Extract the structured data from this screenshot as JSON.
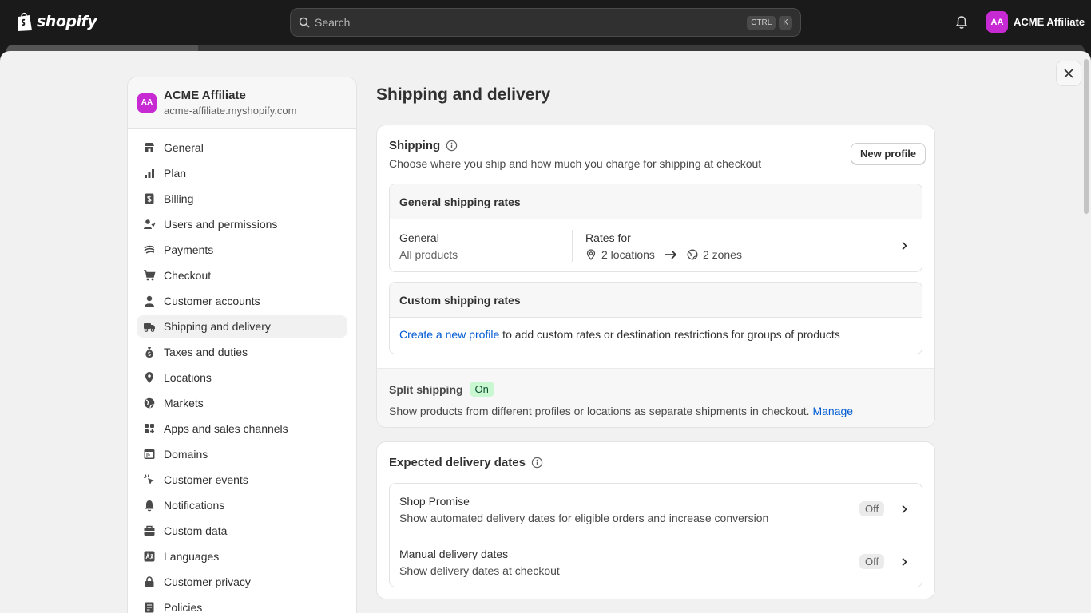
{
  "topbar": {
    "brand": "shopify",
    "search_placeholder": "Search",
    "shortcut_ctrl": "CTRL",
    "shortcut_key": "K",
    "account_initials": "AA",
    "account_name": "ACME Affiliate"
  },
  "store": {
    "initials": "AA",
    "name": "ACME Affiliate",
    "domain": "acme-affiliate.myshopify.com"
  },
  "sidebar": {
    "items": [
      {
        "label": "General",
        "icon": "store-icon"
      },
      {
        "label": "Plan",
        "icon": "plan-chart-icon"
      },
      {
        "label": "Billing",
        "icon": "billing-dollar-icon"
      },
      {
        "label": "Users and permissions",
        "icon": "users-icon"
      },
      {
        "label": "Payments",
        "icon": "payments-icon"
      },
      {
        "label": "Checkout",
        "icon": "cart-icon"
      },
      {
        "label": "Customer accounts",
        "icon": "person-icon"
      },
      {
        "label": "Shipping and delivery",
        "icon": "truck-icon",
        "active": true
      },
      {
        "label": "Taxes and duties",
        "icon": "tax-bag-icon"
      },
      {
        "label": "Locations",
        "icon": "location-pin-icon"
      },
      {
        "label": "Markets",
        "icon": "globe-icon"
      },
      {
        "label": "Apps and sales channels",
        "icon": "apps-grid-icon"
      },
      {
        "label": "Domains",
        "icon": "domains-icon"
      },
      {
        "label": "Customer events",
        "icon": "cursor-click-icon"
      },
      {
        "label": "Notifications",
        "icon": "bell-icon"
      },
      {
        "label": "Custom data",
        "icon": "custom-data-icon"
      },
      {
        "label": "Languages",
        "icon": "translate-icon"
      },
      {
        "label": "Customer privacy",
        "icon": "lock-icon"
      },
      {
        "label": "Policies",
        "icon": "policies-icon"
      }
    ]
  },
  "page": {
    "title": "Shipping and delivery"
  },
  "shipping": {
    "title": "Shipping",
    "description": "Choose where you ship and how much you charge for shipping at checkout",
    "new_profile": "New profile",
    "general_rates_title": "General shipping rates",
    "general_label": "General",
    "general_sub": "All products",
    "rates_for": "Rates for",
    "locations": "2 locations",
    "zones": "2 zones",
    "custom_rates_title": "Custom shipping rates",
    "create_link": "Create a new profile",
    "create_rest": " to add custom rates or destination restrictions for groups of products",
    "split_title": "Split shipping",
    "split_badge": "On",
    "split_desc": "Show products from different profiles or locations as separate shipments in checkout.",
    "split_manage": "Manage"
  },
  "delivery": {
    "title": "Expected delivery dates",
    "items": [
      {
        "title": "Shop Promise",
        "desc": "Show automated delivery dates for eligible orders and increase conversion",
        "badge": "Off"
      },
      {
        "title": "Manual delivery dates",
        "desc": "Show delivery dates at checkout",
        "badge": "Off"
      }
    ]
  },
  "colors": {
    "accent_link": "#005bd3",
    "avatar": "#c72ad3",
    "badge_on_bg": "#c9f7d1"
  }
}
